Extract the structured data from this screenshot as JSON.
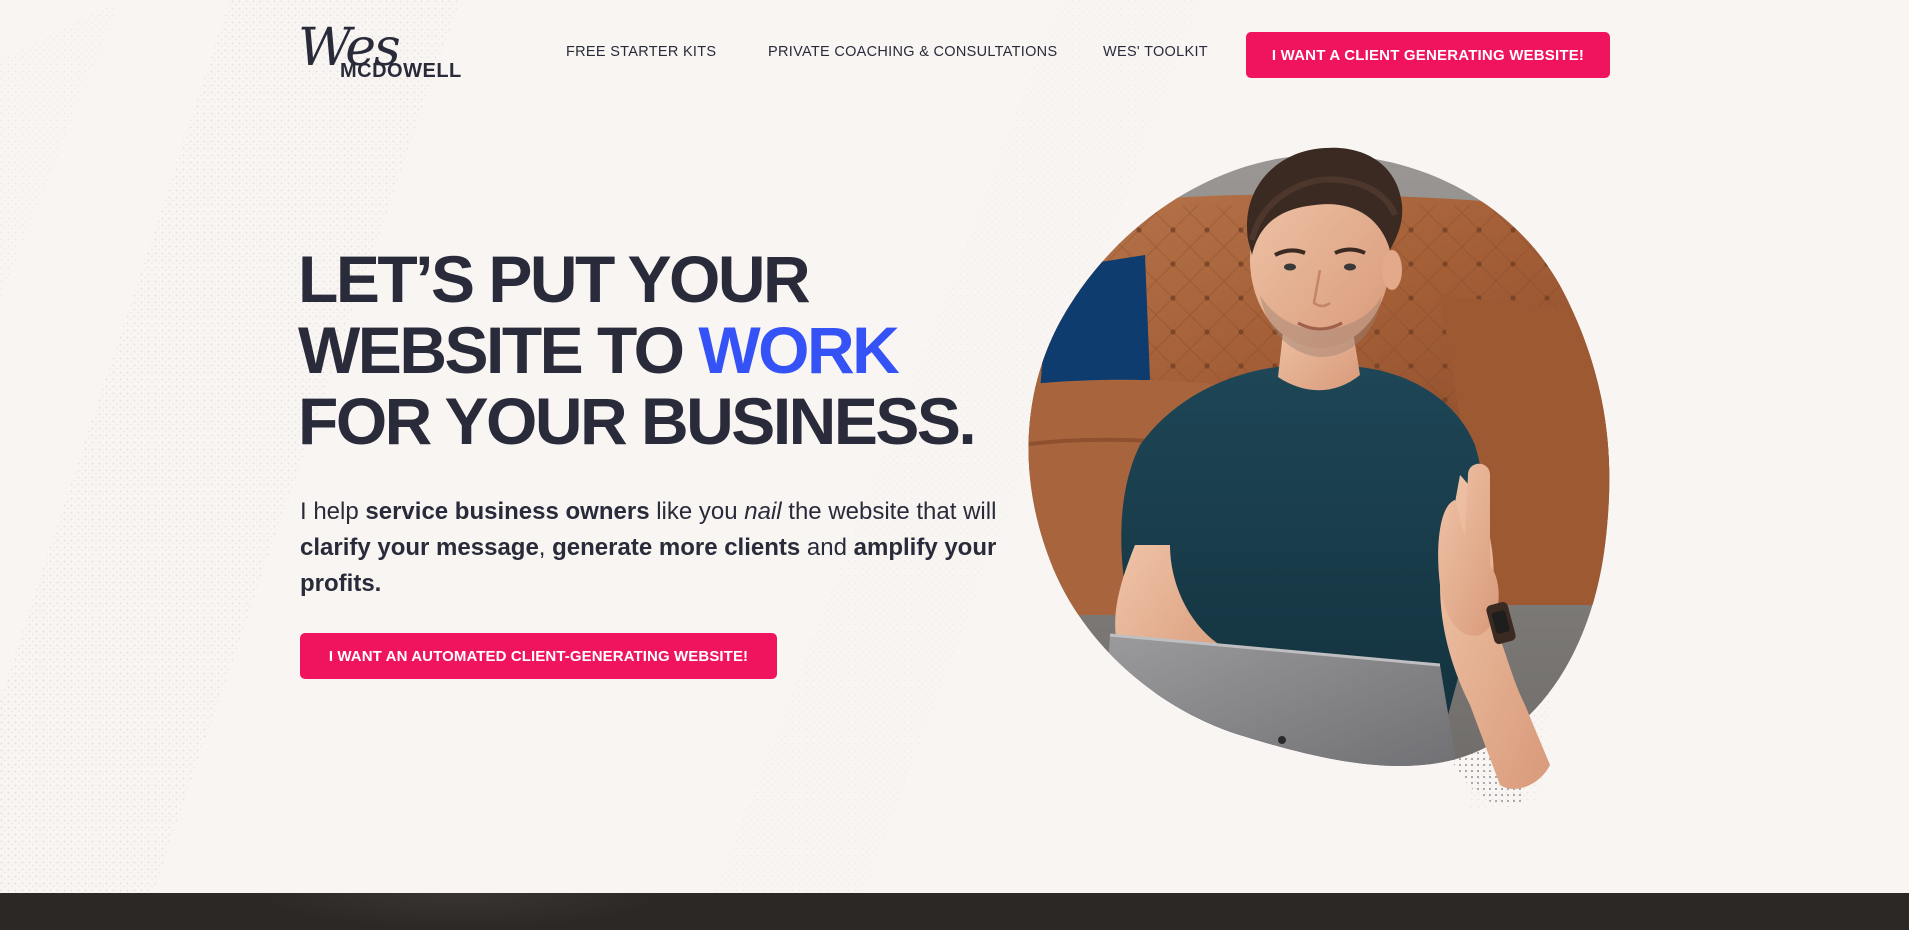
{
  "header": {
    "logo": {
      "script": "Wes",
      "word": "MCDOWELL"
    },
    "nav": [
      {
        "label": "FREE STARTER KITS"
      },
      {
        "label": "PRIVATE COACHING & CONSULTATIONS"
      },
      {
        "label": "WES' TOOLKIT"
      }
    ],
    "cta_label": "I WANT A CLIENT GENERATING WEBSITE!"
  },
  "hero": {
    "headline": {
      "line1": "LET’S PUT YOUR",
      "line2_start": "WEBSITE TO ",
      "line2_accent": "WORK",
      "line3": "FOR YOUR BUSINESS."
    },
    "subtext": {
      "p1": "I help ",
      "b1": "service business owners",
      "p2": " like you ",
      "i1": "nail",
      "p3": " the website that will ",
      "b2": "clarify your message",
      "p4": ", ",
      "b3": "generate more clients",
      "p5": " and ",
      "b4": "amplify your profits."
    },
    "cta_label": "I WANT AN AUTOMATED CLIENT-GENERATING WEBSITE!"
  },
  "colors": {
    "background": "#f8f5f2",
    "text": "#2a2b3a",
    "accent_blue": "#3452f5",
    "cta_pink": "#f0135e",
    "footer_band": "#2b2826"
  },
  "icons": {
    "portrait": "person-photo"
  }
}
